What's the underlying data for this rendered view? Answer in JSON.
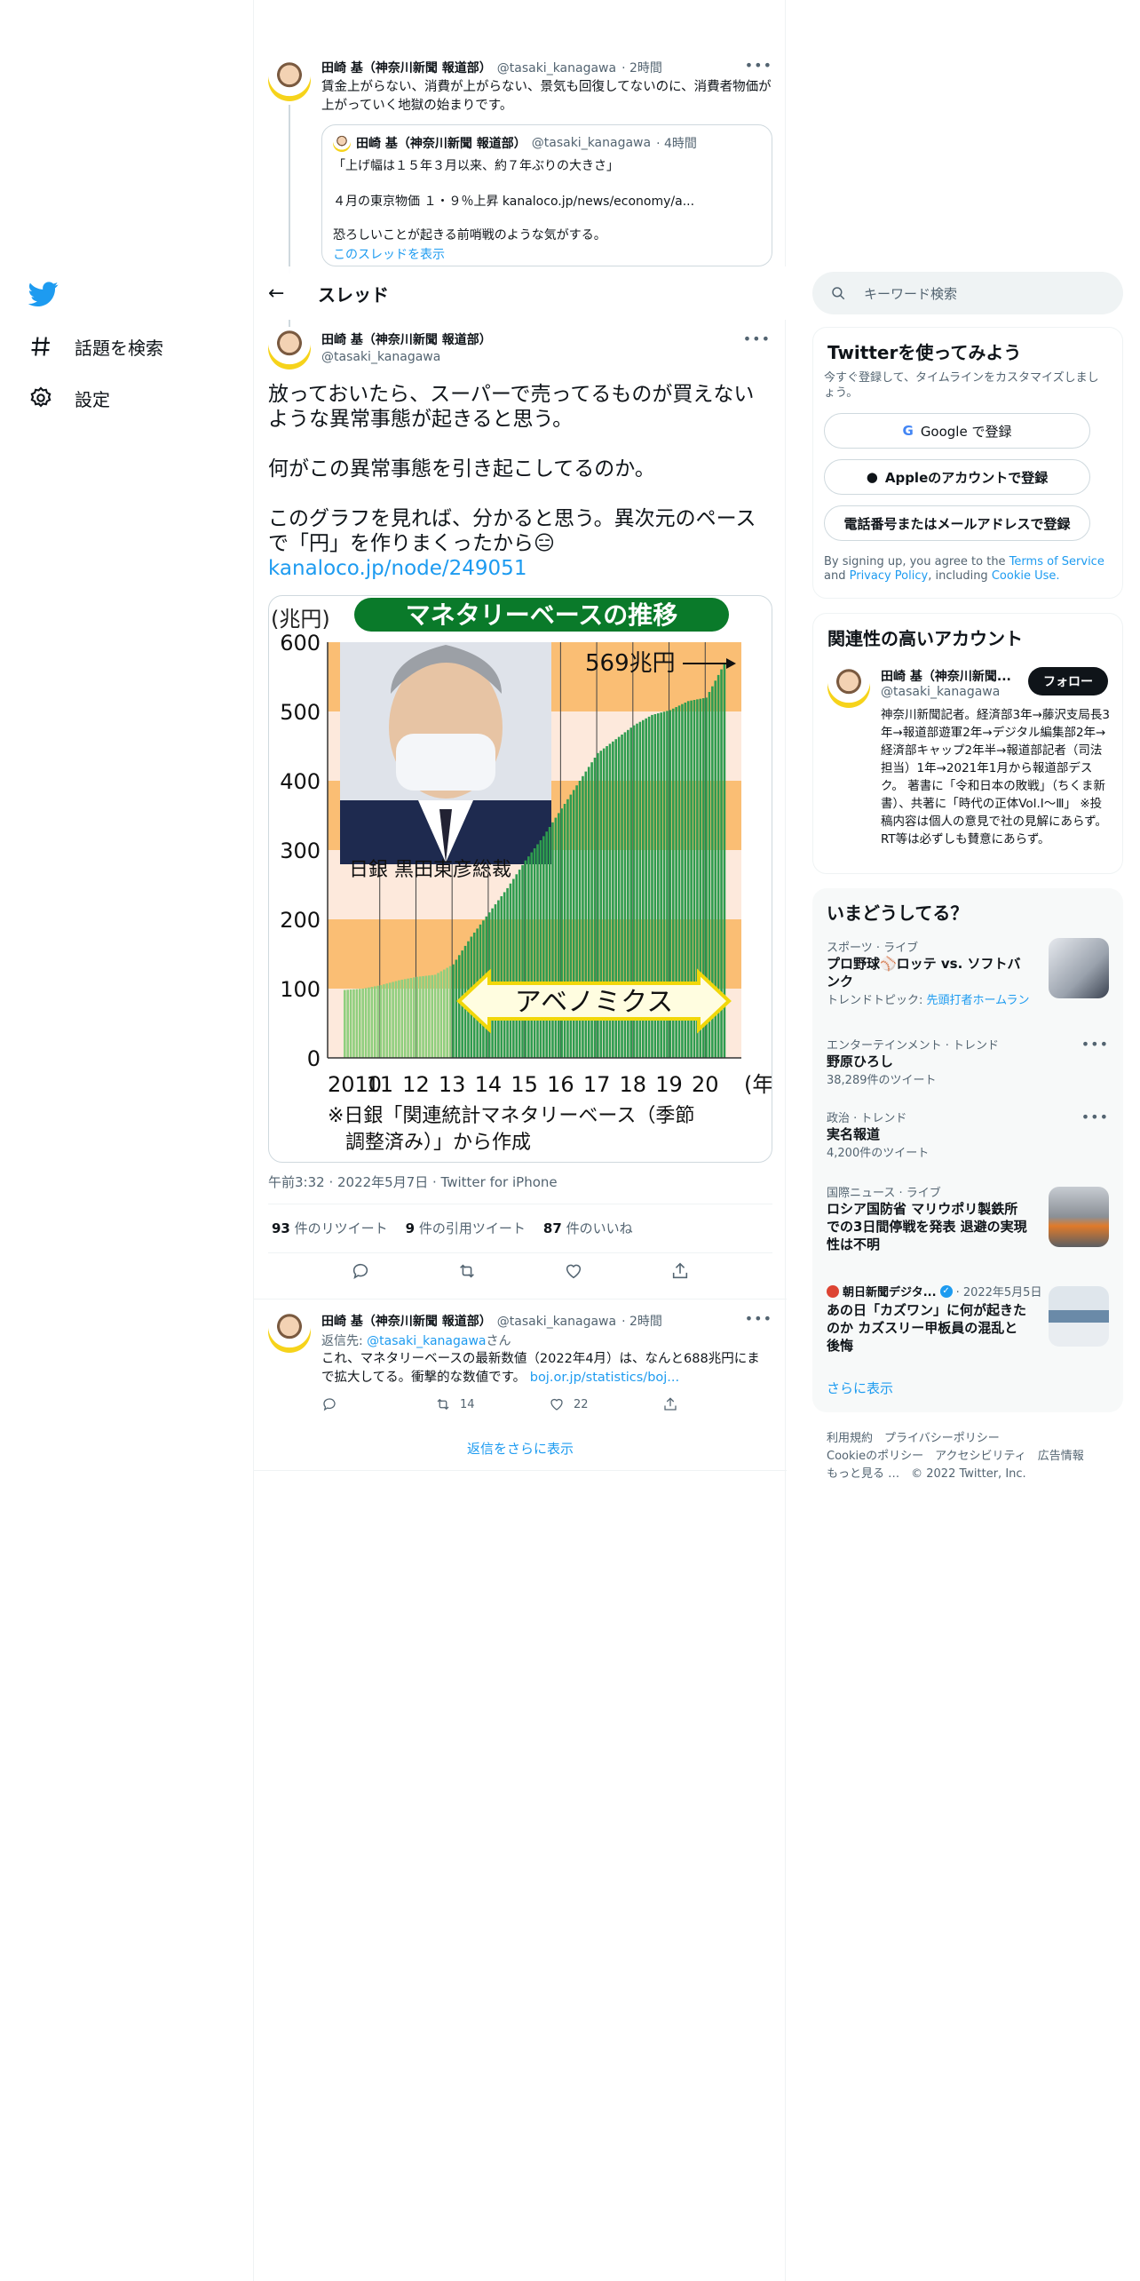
{
  "nav": {
    "items": [
      {
        "label": "話題を検索",
        "icon": "hashtag-icon"
      },
      {
        "label": "設定",
        "icon": "gear-icon"
      }
    ]
  },
  "tweet1": {
    "name": "田崎 基（神奈川新聞 報道部）",
    "handle": "@tasaki_kanagawa",
    "time": "· 2時間",
    "text": "賃金上がらない、消費が上がらない、景気も回復してないのに、消費者物価が上がっていく地獄の始まりです。",
    "quote": {
      "name": "田崎 基（神奈川新聞 報道部）",
      "handle": "@tasaki_kanagawa",
      "time": "· 4時間",
      "line1": "「上げ幅は１５年３月以来、約７年ぶりの大きさ」",
      "line2": "４月の東京物価 １・９％上昇 kanaloco.jp/news/economy/a...",
      "line3": "恐ろしいことが起きる前哨戦のような気がする。",
      "show_thread": "このスレッドを表示"
    }
  },
  "thread_header": {
    "title": "スレッド"
  },
  "main_tweet": {
    "name": "田崎 基（神奈川新聞 報道部）",
    "handle": "@tasaki_kanagawa",
    "para1": "放っておいたら、スーパーで売ってるものが買えないような異常事態が起きると思う。",
    "para2": "何がこの異常事態を引き起こしてるのか。",
    "para3": "このグラフを見れば、分かると思う。異次元のペースで「円」を作りまくったから😑",
    "link": "kanaloco.jp/node/249051",
    "meta": "午前3:32 · 2022年5月7日 · Twitter for iPhone",
    "retweets": "93",
    "retweets_label": "件のリツイート",
    "quotes": "9",
    "quotes_label": "件の引用ツイート",
    "likes": "87",
    "likes_label": "件のいいね"
  },
  "chart_data": {
    "type": "bar",
    "title": "マネタリーベースの推移",
    "ylabel": "(兆円)",
    "xlabel": "(年)",
    "ylim": [
      0,
      600
    ],
    "yticks": [
      "600",
      "500",
      "400",
      "300",
      "200",
      "100",
      "0"
    ],
    "xticks": [
      "2010",
      "11",
      "12",
      "13",
      "14",
      "15",
      "16",
      "17",
      "18",
      "19",
      "20"
    ],
    "x_unit": "(年)",
    "callout": "569兆円",
    "photo_caption": "日銀 黒田東彦総裁",
    "band_label": "アベノミクス",
    "source": "※日銀「関連統計マネタリーベース（季節調整済み）」から作成",
    "series": [
      {
        "x": 2010.0,
        "y": 98
      },
      {
        "x": 2010.5,
        "y": 100
      },
      {
        "x": 2011.0,
        "y": 105
      },
      {
        "x": 2011.5,
        "y": 112
      },
      {
        "x": 2012.0,
        "y": 117
      },
      {
        "x": 2012.5,
        "y": 120
      },
      {
        "x": 2013.0,
        "y": 135
      },
      {
        "x": 2013.5,
        "y": 175
      },
      {
        "x": 2014.0,
        "y": 210
      },
      {
        "x": 2014.5,
        "y": 245
      },
      {
        "x": 2015.0,
        "y": 285
      },
      {
        "x": 2015.5,
        "y": 320
      },
      {
        "x": 2016.0,
        "y": 360
      },
      {
        "x": 2016.5,
        "y": 400
      },
      {
        "x": 2017.0,
        "y": 440
      },
      {
        "x": 2017.5,
        "y": 460
      },
      {
        "x": 2018.0,
        "y": 480
      },
      {
        "x": 2018.5,
        "y": 495
      },
      {
        "x": 2019.0,
        "y": 502
      },
      {
        "x": 2019.5,
        "y": 515
      },
      {
        "x": 2020.0,
        "y": 520
      },
      {
        "x": 2020.5,
        "y": 569
      }
    ]
  },
  "reply": {
    "name": "田崎 基（神奈川新聞 報道部）",
    "handle": "@tasaki_kanagawa",
    "time": "· 2時間",
    "reply_to_prefix": "返信先:",
    "reply_to_handle": "@tasaki_kanagawa",
    "reply_to_suffix": "さん",
    "text": "これ、マネタリーベースの最新数値（2022年4月）は、なんと688兆円にまで拡大してる。衝撃的な数値です。",
    "link": "boj.or.jp/statistics/boj...",
    "retweets": "14",
    "likes": "22"
  },
  "show_more_replies": "返信をさらに表示",
  "search": {
    "placeholder": "キーワード検索"
  },
  "signup": {
    "title": "Twitterを使ってみよう",
    "subtitle": "今すぐ登録して、タイムラインをカスタマイズしましょう。",
    "google": "Google で登録",
    "apple": "Appleのアカウントで登録",
    "phone": "電話番号またはメールアドレスで登録",
    "legal_prefix": "By signing up, you agree to the",
    "terms": "Terms of Service",
    "and": "and",
    "privacy": "Privacy Policy",
    "including": ", including",
    "cookie": "Cookie Use."
  },
  "related": {
    "title": "関連性の高いアカウント",
    "name": "田崎 基（神奈川新聞...",
    "handle": "@tasaki_kanagawa",
    "follow": "フォロー",
    "bio": "神奈川新聞記者。経済部3年→藤沢支局長3年→報道部遊軍2年→デジタル編集部2年→経済部キャップ2年半→報道部記者（司法担当）1年→2021年1月から報道部デスク。 著書に「令和日本の敗戦」（ちくま新書）、共著に「時代の正体Vol.Ⅰ〜Ⅲ」 ※投稿内容は個人の意見で社の見解にあらず。RT等は必ずしも賛意にあらず。"
  },
  "trends": {
    "title": "いまどうしてる？",
    "items": [
      {
        "category": "スポーツ · ライブ",
        "title": "プロ野球⚾ロッテ vs. ソフトバンク",
        "extra_prefix": "トレンドトピック:",
        "extra_link": "先頭打者ホームラン"
      },
      {
        "category": "エンターテインメント · トレンド",
        "title": "野原ひろし",
        "count": "38,289件のツイート"
      },
      {
        "category": "政治 · トレンド",
        "title": "実名報道",
        "count": "4,200件のツイート"
      },
      {
        "category": "国際ニュース · ライブ",
        "title": "ロシア国防省 マリウポリ製鉄所での3日間停戦を発表 退避の実現性は不明"
      },
      {
        "category": "朝日新聞デジタ...",
        "date": "· 2022年5月5日",
        "title": "あの日「カズワン」に何が起きたのか カズスリー甲板員の混乱と後悔"
      }
    ],
    "show_more": "さらに表示"
  },
  "footer": {
    "line1": "利用規約　プライバシーポリシー",
    "line2": "Cookieのポリシー　アクセシビリティ　広告情報",
    "line3": "もっと見る …　© 2022 Twitter, Inc."
  },
  "colors": {
    "accent": "#1d9bf0",
    "chart_green": "#2e9c4f",
    "chart_title_bg": "#0a7a2a",
    "band_orange": "#f9b35c"
  }
}
